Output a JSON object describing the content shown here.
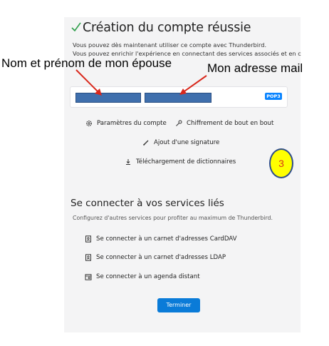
{
  "header": {
    "title": "Création du compte réussie",
    "message_line1": "Vous pouvez dès maintenant utiliser ce compte avec Thunderbird.",
    "message_line2": "Vous pouvez enrichir l'expérience en connectant des services associés et en c"
  },
  "annotations": {
    "name_label": "Nom et prénom de mon épouse",
    "mail_label": "Mon adresse mail",
    "step_number": "3",
    "arrow_color": "#d9281c",
    "badge_color": "#ffff00"
  },
  "account": {
    "protocol_badge": "POP3",
    "redaction_color": "#3f6fad"
  },
  "actions": {
    "settings": "Paramètres du compte",
    "encryption": "Chiffrement de bout en bout",
    "signature": "Ajout d'une signature",
    "dictionaries": "Téléchargement de dictionnaires"
  },
  "services": {
    "title": "Se connecter à vos services liés",
    "subtitle": "Configurez d'autres services pour profiter au maximum de Thunderbird.",
    "carddav": "Se connecter à un carnet d'adresses CardDAV",
    "ldap": "Se connecter à un carnet d'adresses LDAP",
    "calendar": "Se connecter à un agenda distant"
  },
  "footer": {
    "finish_label": "Terminer"
  },
  "colors": {
    "accent": "#0a7bd8",
    "success": "#2e9e4a",
    "panel_bg": "#f4f4f5"
  }
}
